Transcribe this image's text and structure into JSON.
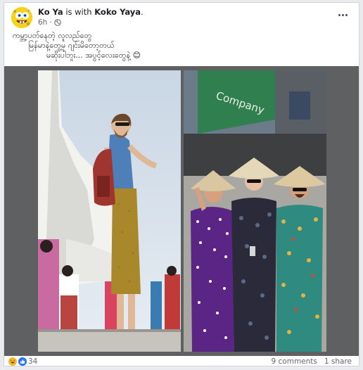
{
  "post": {
    "author": "Ko Ya",
    "with_text": "is with",
    "tagged": "Koko Yaya",
    "tagged_suffix": ".",
    "time": "6h",
    "time_sep": "·",
    "caption_lines": [
      "ကမ္ဘာ့ပတ်နေတဲ့ လူလည်တွေ",
      "မြန်မာနဲ့တွေ့မှ ဂျင်းမိတော့တယ်",
      "မဆိုးပါဘူး... အပွင့်လေးတွေနဲ့ 😊"
    ]
  },
  "reactions": {
    "count": "34",
    "icons": [
      "haha-icon",
      "like-icon"
    ]
  },
  "stats": {
    "comments": "9 comments",
    "shares": "1 share"
  },
  "colors": {
    "like": "#2078f4",
    "haha": "#f7b928",
    "avatar": "#f5d21b",
    "frame": "#5f6062"
  }
}
